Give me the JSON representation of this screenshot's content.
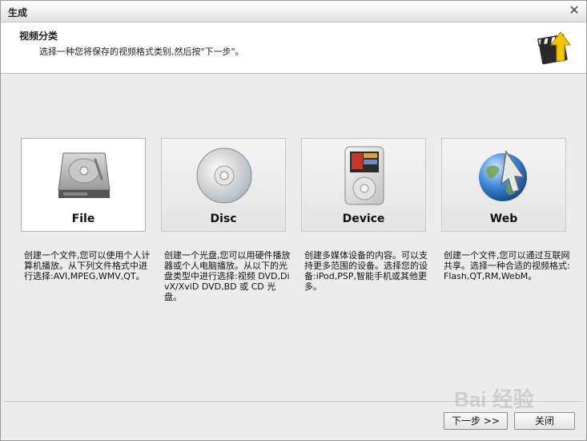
{
  "window": {
    "title": "生成",
    "close_symbol": "✕"
  },
  "header": {
    "title": "视频分类",
    "subtitle": "选择一种您将保存的视频格式类别,然后按\"下一步\"。",
    "logo_icon": "clapperboard-arrow-icon"
  },
  "cards": [
    {
      "label": "File",
      "icon": "hard-drive-icon",
      "selected": true,
      "description": "创建一个文件,您可以使用个人计算机播放。从下列文件格式中进行选择:AVI,MPEG,WMV,QT。"
    },
    {
      "label": "Disc",
      "icon": "disc-icon",
      "selected": false,
      "description": "创建一个光盘,您可以用硬件播放器或个人电脑播放。从以下的光盘类型中进行选择:视频 DVD,DivX/XviD DVD,BD 或 CD 光盘。"
    },
    {
      "label": "Device",
      "icon": "media-player-icon",
      "selected": false,
      "description": "创建多媒体设备的内容。可以支持更多范围的设备。选择您的设备:iPod,PSP,智能手机或其他更多。"
    },
    {
      "label": "Web",
      "icon": "globe-cursor-icon",
      "selected": false,
      "description": "创建一个文件,您可以通过互联网共享。选择一种合适的视频格式:Flash,QT,RM,WebM。"
    }
  ],
  "buttons": {
    "next_label": "下一步 >>",
    "close_label": "关闭"
  },
  "watermark": {
    "text": "Bai 经验"
  }
}
